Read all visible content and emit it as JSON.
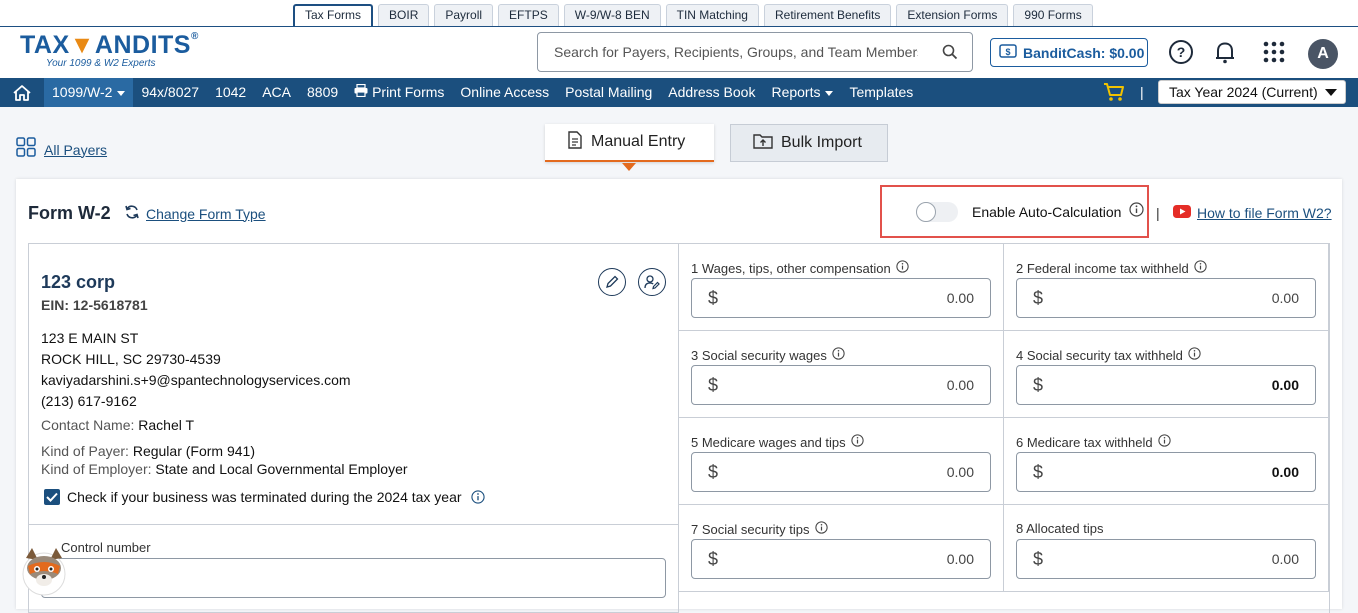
{
  "tabs": [
    {
      "label": "Tax Forms",
      "active": true
    },
    {
      "label": "BOIR"
    },
    {
      "label": "Payroll"
    },
    {
      "label": "EFTPS"
    },
    {
      "label": "W-9/W-8 BEN"
    },
    {
      "label": "TIN Matching"
    },
    {
      "label": "Retirement Benefits"
    },
    {
      "label": "Extension Forms"
    },
    {
      "label": "990 Forms"
    }
  ],
  "logo": {
    "left": "TAX",
    "right": "ANDITS",
    "tagline": "Your 1099 & W2 Experts",
    "reg": "®"
  },
  "search": {
    "placeholder": "Search for Payers, Recipients, Groups, and Team Members"
  },
  "bandit_cash": "BanditCash: $0.00",
  "avatar": "A",
  "nav": {
    "items": [
      "1099/W-2",
      "94x/8027",
      "1042",
      "ACA",
      "8809",
      "Print Forms",
      "Online Access",
      "Postal Mailing",
      "Address Book",
      "Reports",
      "Templates"
    ],
    "separator": "|",
    "tax_year": "Tax Year 2024 (Current)"
  },
  "all_payers": "All Payers",
  "entry_modes": {
    "manual": "Manual Entry",
    "bulk": "Bulk Import"
  },
  "form": {
    "title": "Form W-2",
    "change_type": "Change Form Type",
    "auto_calc": "Enable Auto-Calculation",
    "auto_calc_enabled": false,
    "separator": "|",
    "how_to": "How to file Form W2?"
  },
  "payer": {
    "name": "123 corp",
    "ein": "EIN: 12-5618781",
    "address1": "123 E MAIN ST",
    "address2": "ROCK HILL, SC 29730-4539",
    "email": "kaviyadarshini.s+9@spantechnologyservices.com",
    "phone": "(213) 617-9162",
    "contact_label": "Contact Name:",
    "contact_value": "Rachel T",
    "kind_payer_label": "Kind of Payer:",
    "kind_payer_value": "Regular (Form 941)",
    "kind_employer_label": "Kind of Employer:",
    "kind_employer_value": "State and Local Governmental Employer",
    "terminated_label": "Check if your business was terminated during the 2024 tax year",
    "terminated_checked": true,
    "control_label": "Control number"
  },
  "boxes": [
    {
      "label": "1  Wages, tips, other compensation",
      "currency": "$",
      "value": "0.00",
      "bold": false
    },
    {
      "label": "2  Federal income tax withheld",
      "currency": "$",
      "value": "0.00",
      "bold": false
    },
    {
      "label": "3  Social security wages",
      "currency": "$",
      "value": "0.00",
      "bold": false
    },
    {
      "label": "4   Social security tax withheld",
      "currency": "$",
      "value": "0.00",
      "bold": true
    },
    {
      "label": "5  Medicare wages and tips",
      "currency": "$",
      "value": "0.00",
      "bold": false
    },
    {
      "label": "6   Medicare tax withheld",
      "currency": "$",
      "value": "0.00",
      "bold": true
    },
    {
      "label": "7  Social security tips",
      "currency": "$",
      "value": "0.00",
      "bold": false
    },
    {
      "label": "8   Allocated tips",
      "currency": "$",
      "value": "0.00",
      "bold": false
    }
  ],
  "colors": {
    "brand_blue": "#1b4f7e",
    "accent_orange": "#e36a1e",
    "highlight_red": "#e2514b"
  }
}
